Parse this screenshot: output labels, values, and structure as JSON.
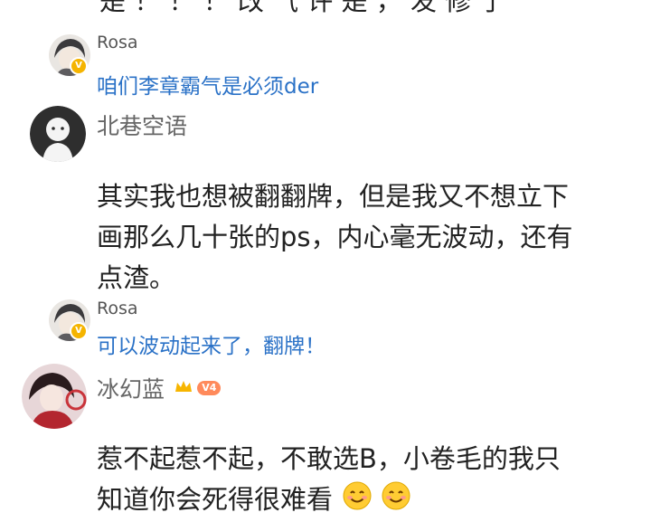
{
  "top_partial_text": "是 ！ ！ ！ 改 气 许 是 ， 发 修 了",
  "comments": [
    {
      "kind": "reply",
      "user": "Rosa",
      "text": "咱们李章霸气是必须der",
      "badge": "V"
    },
    {
      "kind": "main",
      "user": "北巷空语",
      "text_lines": [
        "其实我也想被翻翻牌，但是我又不想立下",
        "画那么几十张的ps，内心毫无波动，还有",
        "点渣。"
      ]
    },
    {
      "kind": "reply",
      "user": "Rosa",
      "text": "可以波动起来了，翻牌！",
      "badge": "V"
    },
    {
      "kind": "main",
      "user": "冰幻蓝",
      "level": "V4",
      "text_lines": [
        "惹不起惹不起，不敢选B，小卷毛的我只",
        "知道你会死得很难看"
      ],
      "emoji": [
        "smiling-face",
        "smiling-face"
      ]
    }
  ],
  "colors": {
    "reply_text": "#2b72c7",
    "badge": "#f5b400",
    "level_badge": "#ff8a5b"
  }
}
